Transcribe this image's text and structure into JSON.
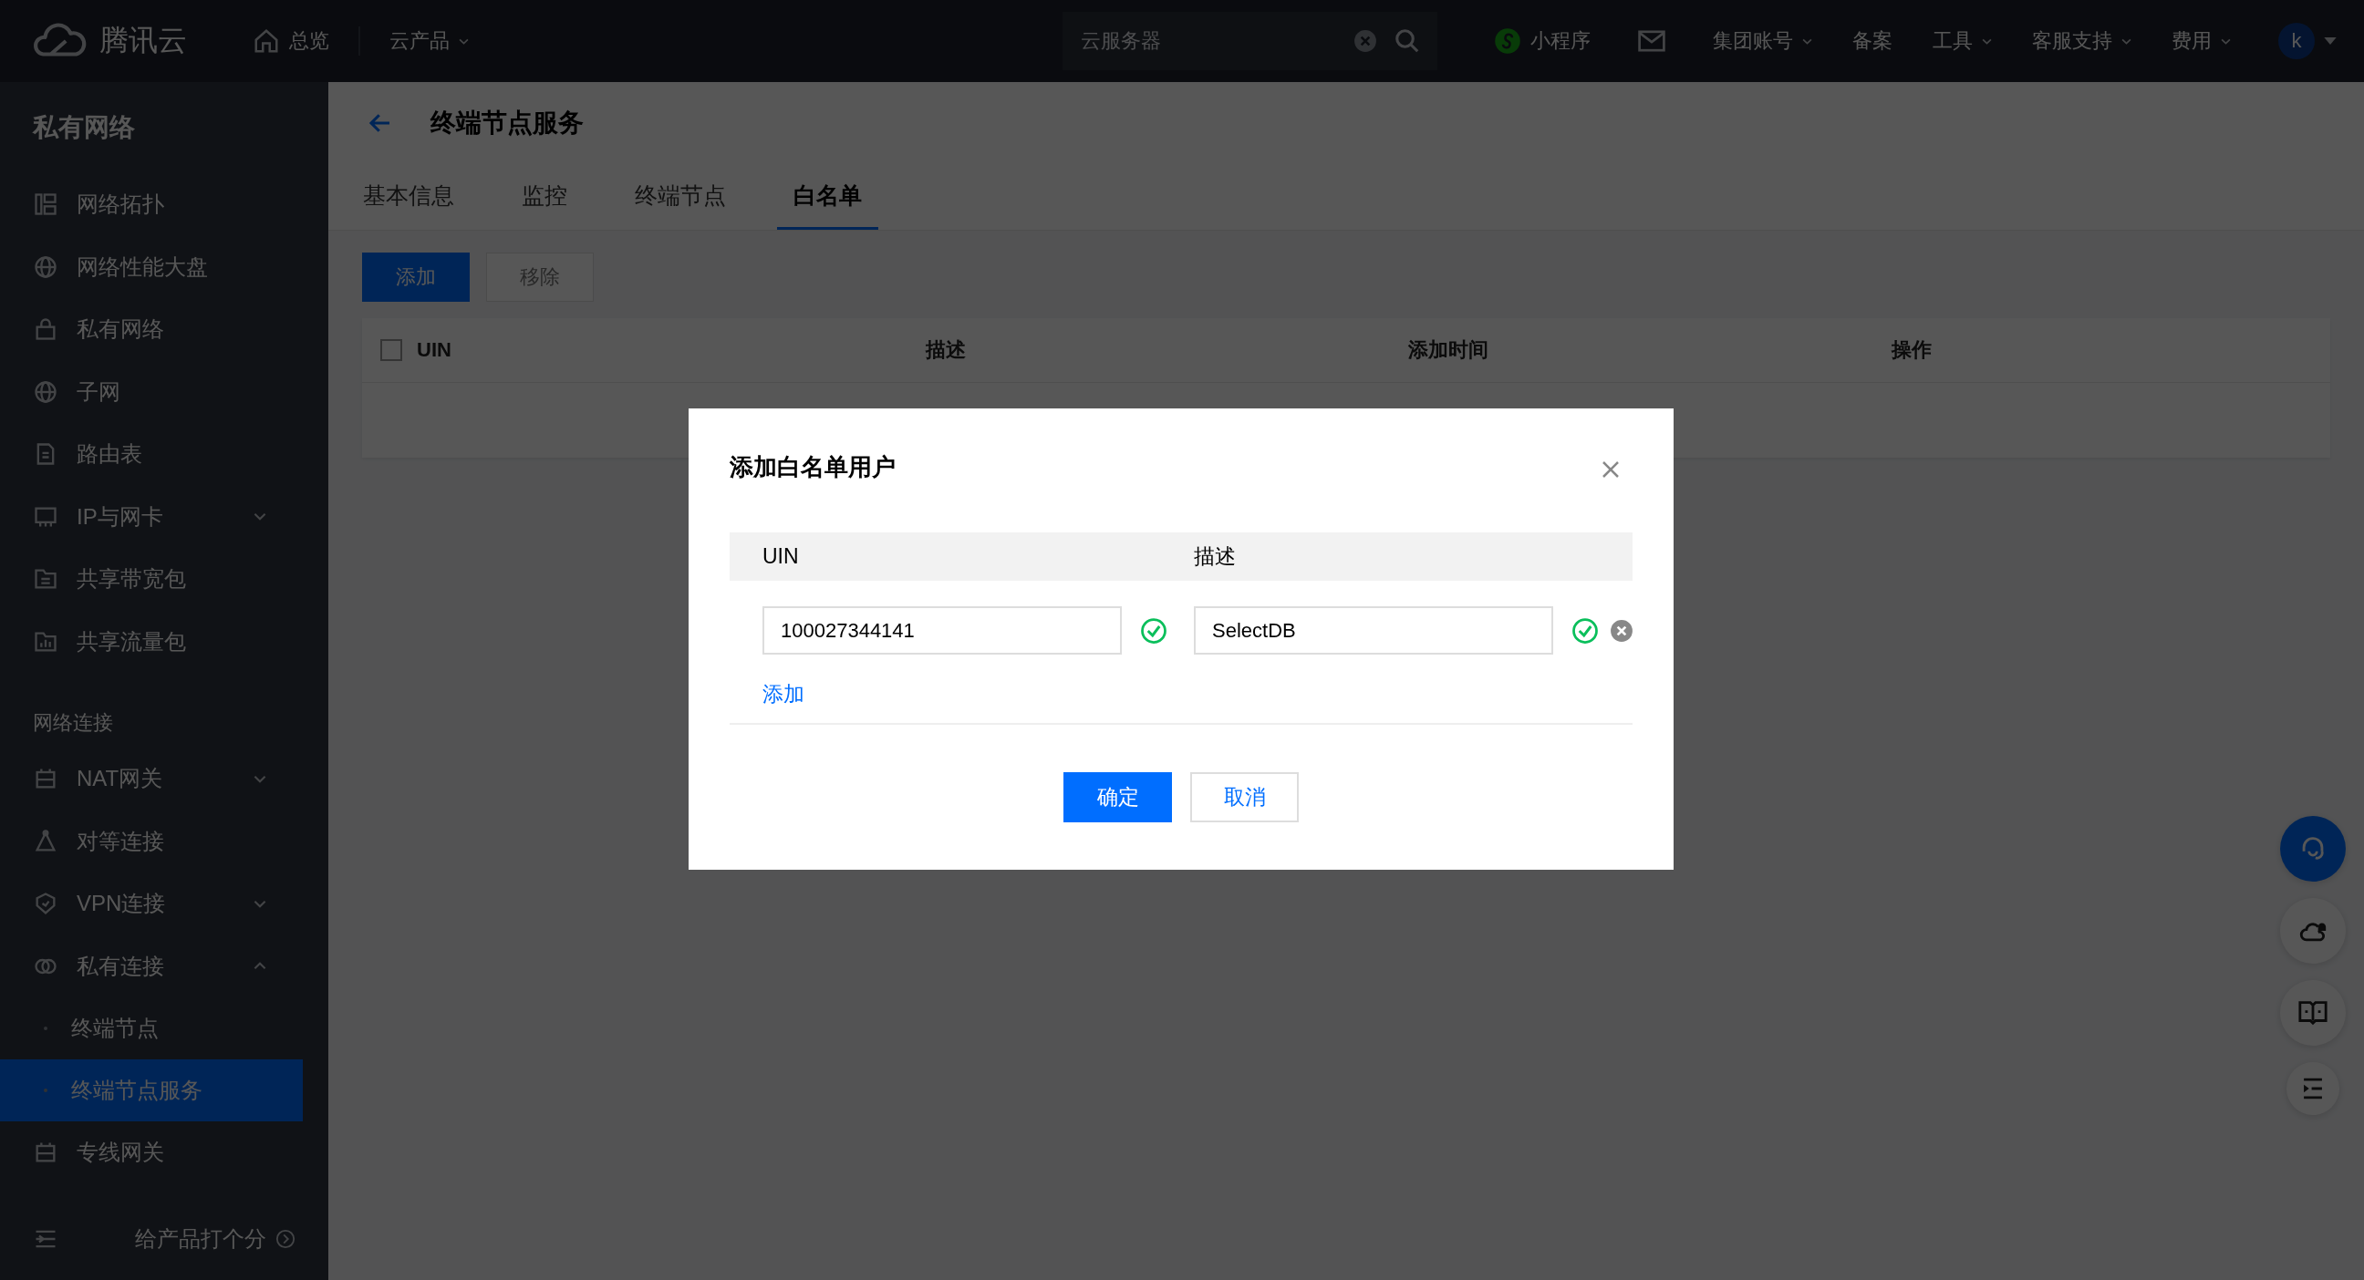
{
  "topbar": {
    "logo_text": "腾讯云",
    "nav": [
      {
        "label": "总览",
        "kind": "home"
      },
      {
        "label": "云产品",
        "kind": "dropdown"
      }
    ],
    "search": {
      "placeholder": "云服务器"
    },
    "items": [
      {
        "label": "小程序",
        "kind": "miniapp"
      },
      {
        "kind": "mail"
      },
      {
        "label": "集团账号",
        "kind": "dropdown"
      },
      {
        "label": "备案",
        "kind": "plain"
      },
      {
        "label": "工具",
        "kind": "dropdown"
      },
      {
        "label": "客服支持",
        "kind": "dropdown"
      },
      {
        "label": "费用",
        "kind": "dropdown"
      }
    ],
    "avatar": "k"
  },
  "sidebar": {
    "title": "私有网络",
    "items": [
      {
        "kind": "link",
        "label": "网络拓扑",
        "selected": false
      },
      {
        "kind": "link",
        "label": "网络性能大盘",
        "selected": false
      },
      {
        "kind": "link",
        "label": "私有网络",
        "selected": false
      },
      {
        "kind": "link",
        "label": "子网",
        "selected": false
      },
      {
        "kind": "link",
        "label": "路由表",
        "selected": false
      },
      {
        "kind": "group",
        "label": "IP与网卡",
        "selected": false,
        "expanded": false
      },
      {
        "kind": "link",
        "label": "共享带宽包",
        "selected": false
      },
      {
        "kind": "link",
        "label": "共享流量包",
        "selected": false
      },
      {
        "kind": "section",
        "label": "网络连接"
      },
      {
        "kind": "group",
        "label": "NAT网关",
        "selected": false,
        "expanded": false
      },
      {
        "kind": "link",
        "label": "对等连接",
        "selected": false
      },
      {
        "kind": "group",
        "label": "VPN连接",
        "selected": false,
        "expanded": false
      },
      {
        "kind": "group",
        "label": "私有连接",
        "selected": false,
        "expanded": true,
        "children": [
          {
            "label": "终端节点",
            "selected": false
          },
          {
            "label": "终端节点服务",
            "selected": true
          }
        ]
      },
      {
        "kind": "link",
        "label": "专线网关",
        "selected": false
      }
    ],
    "footer": "给产品打个分"
  },
  "page": {
    "title": "终端节点服务",
    "tabs": [
      {
        "label": "基本信息",
        "selected": false
      },
      {
        "label": "监控",
        "selected": false
      },
      {
        "label": "终端节点",
        "selected": false
      },
      {
        "label": "白名单",
        "selected": true
      }
    ],
    "buttons": [
      {
        "label": "添加",
        "kind": "primary",
        "disabled": false
      },
      {
        "label": "移除",
        "kind": "default",
        "disabled": true
      }
    ],
    "table": {
      "select_all_checked": false,
      "columns": [
        "UIN",
        "描述",
        "添加时间",
        "操作"
      ]
    }
  },
  "dialog": {
    "title": "添加白名单用户",
    "columns": [
      "UIN",
      "描述"
    ],
    "rows": [
      {
        "uin": "100027344141",
        "uin_valid": true,
        "description": "SelectDB",
        "description_valid": true
      }
    ],
    "add_link": "添加",
    "buttons": [
      {
        "label": "确定",
        "kind": "primary"
      },
      {
        "label": "取消",
        "kind": "default"
      }
    ]
  }
}
